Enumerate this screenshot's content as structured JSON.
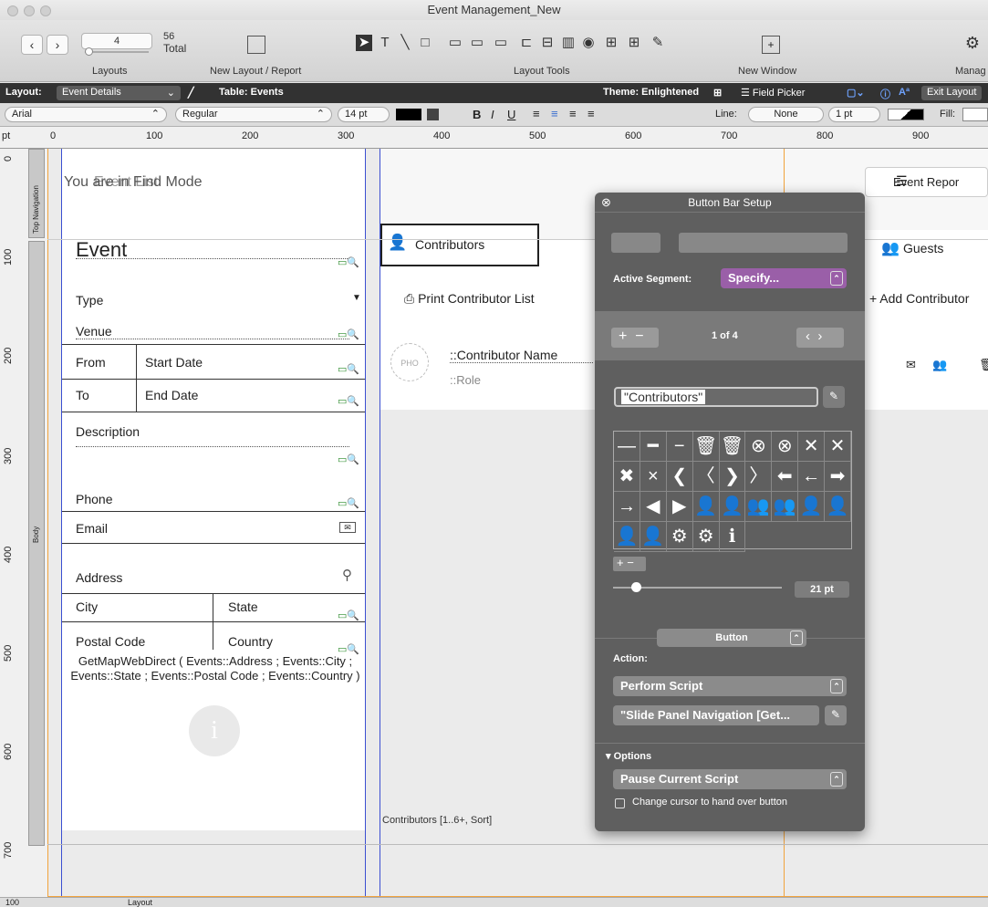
{
  "window": {
    "title": "Event Management_New"
  },
  "toolbar": {
    "layout_number": "4",
    "layout_total": "56",
    "total_label": "Total",
    "layouts_label": "Layouts",
    "new_layout_label": "New Layout / Report",
    "layout_tools_label": "Layout Tools",
    "new_window_label": "New Window",
    "manage_label": "Manag"
  },
  "layout_bar": {
    "layout_label": "Layout:",
    "layout_value": "Event Details",
    "table_label": "Table: Events",
    "theme_label": "Theme: Enlightened",
    "field_picker": "Field Picker",
    "exit_layout": "Exit Layout"
  },
  "format_bar": {
    "font": "Arial",
    "style": "Regular",
    "size": "14 pt",
    "bold": "B",
    "italic": "I",
    "underline": "U",
    "line_label": "Line:",
    "line_value": "None",
    "line_width": "1 pt",
    "fill_label": "Fill:"
  },
  "ruler": {
    "unit": "pt",
    "h_marks": [
      "0",
      "100",
      "200",
      "300",
      "400",
      "500",
      "600",
      "700",
      "800",
      "900"
    ],
    "v_marks": [
      "0",
      "100",
      "200",
      "300",
      "400",
      "500",
      "600",
      "700"
    ],
    "top_nav_part": "Top Navigation",
    "body_part": "Body"
  },
  "left_panel": {
    "mode_text": "You are in Find Mode",
    "event_first": "Event List",
    "event_title": "Event",
    "type": "Type",
    "venue": "Venue",
    "from": "From",
    "start_date": "Start Date",
    "to": "To",
    "end_date": "End Date",
    "description": "Description",
    "phone": "Phone",
    "email": "Email",
    "address": "Address",
    "city": "City",
    "state": "State",
    "postal_code": "Postal Code",
    "country": "Country",
    "calc": "GetMapWebDirect ( Events::Address ; Events::City ; Events::State ; Events::Postal Code ; Events::Country )"
  },
  "right_panel": {
    "event_report": "Event Repor",
    "tab_contributors": "Contributors",
    "tab_guests": "Guests",
    "print_list": "Print Contributor List",
    "add_contributor": "Add Contributor",
    "contributor_name": "::Contributor Name",
    "role": "::Role",
    "portal_label": "Contributors [1..6+, Sort]"
  },
  "popover": {
    "title": "Button Bar Setup",
    "active_segment_label": "Active Segment:",
    "active_segment_value": "Specify...",
    "counter": "1 of 4",
    "segment_name": "\"Contributors\"",
    "icon_size": "21 pt",
    "type_value": "Button",
    "action_label": "Action:",
    "action_value": "Perform Script",
    "script_value": "\"Slide Panel Navigation [Get...",
    "options_label": "Options",
    "options_value": "Pause Current Script",
    "checkbox_label": "Change cursor to hand over button",
    "icons": [
      "—",
      "━",
      "−",
      "🗑",
      "🗑",
      "⊗",
      "⊗",
      "✕",
      "✕",
      "✖",
      "×",
      "❮",
      "〈",
      "❯",
      "〉",
      "⬅",
      "←",
      "➡",
      "→",
      "◀",
      "▶",
      "👤",
      "👤",
      "👥",
      "👥",
      "👤",
      "👤",
      "👤",
      "👤",
      "⚙",
      "⚙",
      "ℹ"
    ]
  },
  "status": {
    "zoom": "100",
    "mode": "Layout"
  },
  "colors": {
    "accent_blue": "#3b4fd1",
    "guide_orange": "#f1a33c",
    "popover_bg": "#5f5f5f",
    "layout_bar_bg": "#323232"
  }
}
